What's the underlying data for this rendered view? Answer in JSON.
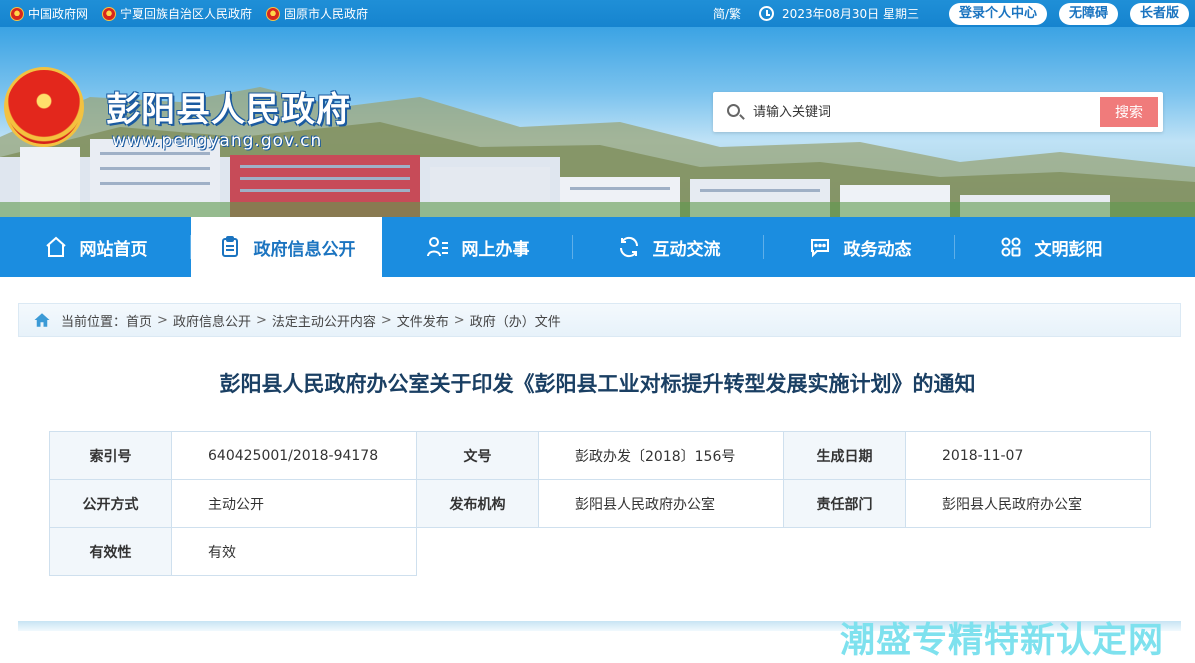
{
  "topbar": {
    "links": [
      "中国政府网",
      "宁夏回族自治区人民政府",
      "固原市人民政府"
    ],
    "lang": "简/繁",
    "date": "2023年08月30日 星期三",
    "buttons": [
      "登录个人中心",
      "无障碍",
      "长者版"
    ]
  },
  "banner": {
    "title": "彭阳县人民政府",
    "url": "www.pengyang.gov.cn",
    "search_placeholder": "请输入关键词",
    "search_button": "搜索"
  },
  "nav": {
    "items": [
      {
        "label": "网站首页",
        "icon": "home-icon"
      },
      {
        "label": "政府信息公开",
        "icon": "document-icon",
        "active": true
      },
      {
        "label": "网上办事",
        "icon": "person-list-icon"
      },
      {
        "label": "互动交流",
        "icon": "refresh-icon"
      },
      {
        "label": "政务动态",
        "icon": "chat-bubble-icon"
      },
      {
        "label": "文明彭阳",
        "icon": "grid-icon"
      }
    ]
  },
  "breadcrumb": {
    "prefix": "当前位置：",
    "items": [
      "首页",
      "政府信息公开",
      "法定主动公开内容",
      "文件发布",
      "政府（办）文件"
    ]
  },
  "doc": {
    "title": "彭阳县人民政府办公室关于印发《彭阳县工业对标提升转型发展实施计划》的通知",
    "meta": {
      "index_label": "索引号",
      "index_value": "640425001/2018-94178",
      "docno_label": "文号",
      "docno_value": "彭政办发〔2018〕156号",
      "date_label": "生成日期",
      "date_value": "2018-11-07",
      "method_label": "公开方式",
      "method_value": "主动公开",
      "issuer_label": "发布机构",
      "issuer_value": "彭阳县人民政府办公室",
      "dept_label": "责任部门",
      "dept_value": "彭阳县人民政府办公室",
      "valid_label": "有效性",
      "valid_value": "有效"
    }
  },
  "watermark": "潮盛专精特新认定网",
  "colors": {
    "primary": "#1b8de0",
    "search_button": "#f07b7b",
    "title": "#1a3f63"
  }
}
